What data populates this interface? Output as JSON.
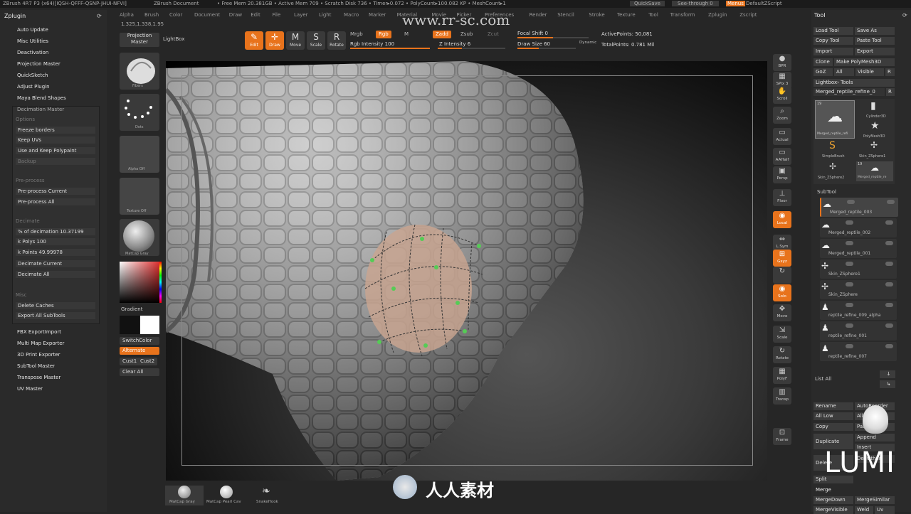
{
  "titlebar": {
    "app": "ZBrush 4R7 P3 (x64)[IQSH-QFFF-QSNP-JHUI-NFVI]",
    "doc": "ZBrush Document",
    "free_mem": "• Free Mem 20.381GB • Active Mem 709 • Scratch Disk 736 • Timer▸0.072 • PolyCount▸100.082 KP • MeshCount▸1",
    "quicksave": "QuickSave",
    "seethrough": "See-through  0",
    "menus": "Menus",
    "script": "DefaultZScript"
  },
  "menubar": [
    "Alpha",
    "Brush",
    "Color",
    "Document",
    "Draw",
    "Edit",
    "File",
    "Layer",
    "Light",
    "Macro",
    "Marker",
    "Material",
    "Movie",
    "Picker",
    "Preferences",
    "Render",
    "Stencil",
    "Stroke",
    "Texture",
    "Tool",
    "Transform",
    "Zplugin",
    "Zscript"
  ],
  "coords": "1.325,1.338,1.95",
  "watermark": "www.rr-sc.com",
  "zplugin": {
    "title": "Zplugin",
    "items_top": [
      "Auto Update",
      "Misc Utilities",
      "Deactivation",
      "Projection Master",
      "QuickSketch",
      "Adjust Plugin",
      "Maya Blend Shapes"
    ],
    "decimation": {
      "title": "Decimation Master",
      "options": "Options",
      "freeze": "Freeze borders",
      "keep_uvs": "Keep UVs",
      "keep_poly": "Use and Keep Polypaint",
      "backup": "Backup",
      "preprocess_hdr": "Pre-process",
      "pre_current": "Pre-process Current",
      "pre_all": "Pre-process All",
      "decimate_hdr": "Decimate",
      "pct": "% of decimation 10.37199",
      "polys": "k Polys 100",
      "points": "k Points 49.99978",
      "dec_current": "Decimate Current",
      "dec_all": "Decimate All",
      "misc": "Misc",
      "del_caches": "Delete Caches",
      "export_all": "Export All SubTools"
    },
    "items_bottom": [
      "FBX ExportImport",
      "Multi Map Exporter",
      "3D Print Exporter",
      "SubTool Master",
      "Transpose Master",
      "UV Master"
    ]
  },
  "leftstrip": {
    "projection": "Projection Master",
    "lightbox": "LightBox",
    "labels": [
      "Fibers",
      "Dots",
      "Alpha Off",
      "Texture Off",
      "MatCap Gray"
    ],
    "gradient": "Gradient",
    "switchcolor": "SwitchColor",
    "alternate": "Alternate",
    "cust1": "Cust1",
    "cust2": "Cust2",
    "clearall": "Clear All",
    "main_color": "#e8731c",
    "secondary_color": "#ffffff"
  },
  "toolbar": {
    "buttons": [
      "Edit",
      "Draw",
      "Move",
      "Scale",
      "Rotate"
    ],
    "mrgb": "Mrgb",
    "rgb": "Rgb",
    "m": "M",
    "zadd": "Zadd",
    "zsub": "Zsub",
    "zcut": "Zcut",
    "rgb_intensity": "Rgb Intensity 100",
    "z_intensity": "Z Intensity 6",
    "focal": "Focal Shift 0",
    "drawsize": "Draw Size 60",
    "dynamic": "Dynamic",
    "active_points": "ActivePoints: 50,081",
    "total_points": "TotalPoints: 0.781 Mil"
  },
  "rightcol": [
    "BPR",
    "SPix 3",
    "Scroll",
    "Zoom",
    "Actual",
    "AAHalf",
    "Persp",
    "Floor",
    "Local",
    "L.Sym",
    "Gxyz",
    "",
    "Solo",
    "Move",
    "Scale",
    "Rotate",
    "PolyF",
    "Transp",
    "Frame"
  ],
  "tool": {
    "title": "Tool",
    "load": "Load Tool",
    "saveas": "Save As",
    "copy": "Copy Tool",
    "paste": "Paste Tool",
    "import": "Import",
    "export": "Export",
    "clone": "Clone",
    "makepoly": "Make PolyMesh3D",
    "goz": "GoZ",
    "all": "All",
    "visible": "Visible",
    "r": "R",
    "lightbox_tools": "Lightbox› Tools",
    "current": "Merged_reptile_refine_0",
    "num": "19",
    "thumbs": [
      "Merged_reptile_refi",
      "Cylinder3D",
      "SimpleBrush",
      "PolyMesh3D",
      "Skin_ZSphere2",
      "Skin_ZSphere1",
      "Merged_reptile_re"
    ],
    "subtool": "SubTool",
    "subtools": [
      "Merged_reptile_003",
      "Merged_reptile_002",
      "Merged_reptile_001",
      "Skin_ZSphere1",
      "Skin_ZSphere",
      "reptile_refine_009_alpha",
      "reptile_refine_001",
      "reptile_refine_007"
    ],
    "listall": "List All",
    "rename": "Rename",
    "autoreorder": "AutoReorder",
    "alllow": "All Low",
    "allhigh": "All High",
    "copy2": "Copy",
    "paste2": "Paste",
    "duplicate": "Duplicate",
    "append": "Append",
    "insert": "Insert",
    "delete": "Delete",
    "delother": "Del Other",
    "split": "Split",
    "merge": "Merge",
    "mergedown": "MergeDown",
    "mergesimilar": "MergeSimilar",
    "mergevisible": "MergeVisible",
    "weld": "Weld",
    "uv": "Uv"
  },
  "bottom": [
    "MatCap Gray",
    "MatCap Pearl Cav",
    "SnakeHook"
  ],
  "brand": "人人素材",
  "lumi": "LUMI"
}
